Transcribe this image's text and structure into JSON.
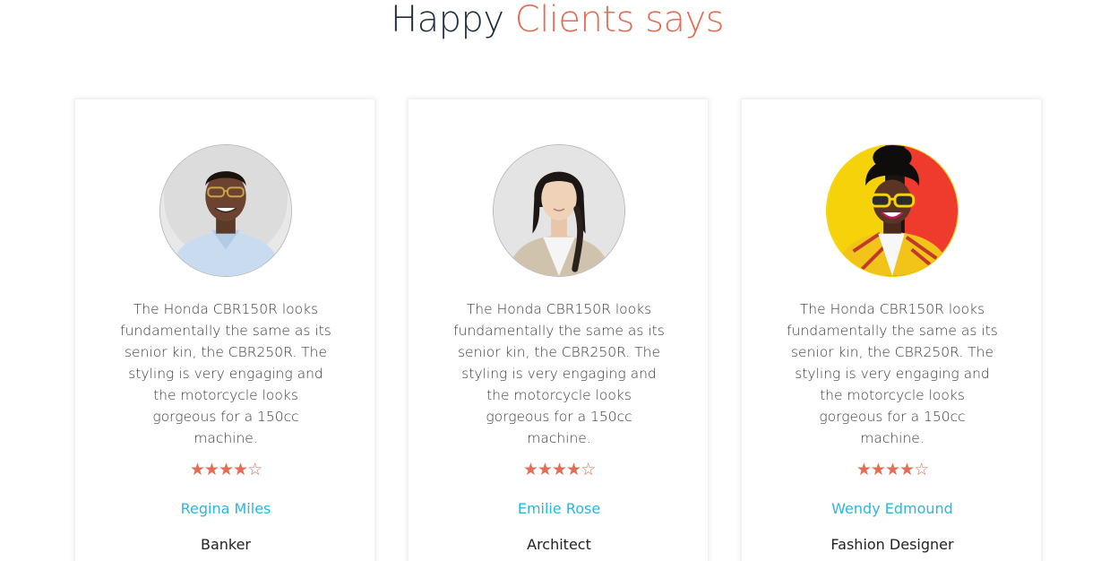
{
  "heading": {
    "plain": "Happy",
    "accent": "Clients says"
  },
  "colors": {
    "accent": "#e36c52",
    "name": "#29b6e3",
    "heading": "#1f2d3d"
  },
  "testimonials": [
    {
      "quote": "The Honda CBR150R looks fundamentally the same as its senior kin, the CBR250R. The styling is very engaging and the motorcycle looks gorgeous for a 150cc machine.",
      "rating": 4,
      "rating_max": 5,
      "name": "Regina Miles",
      "role": "Banker",
      "avatar_icon": "man-with-glasses-photo"
    },
    {
      "quote": "The Honda CBR150R looks fundamentally the same as its senior kin, the CBR250R. The styling is very engaging and the motorcycle looks gorgeous for a 150cc machine.",
      "rating": 4,
      "rating_max": 5,
      "name": "Emilie Rose",
      "role": "Architect",
      "avatar_icon": "woman-with-braid-photo"
    },
    {
      "quote": "The Honda CBR150R looks fundamentally the same as its senior kin, the CBR250R. The styling is very engaging and the motorcycle looks gorgeous for a 150cc machine.",
      "rating": 4,
      "rating_max": 5,
      "name": "Wendy Edmound",
      "role": "Fashion Designer",
      "avatar_icon": "woman-with-yellow-sunglasses-photo"
    }
  ]
}
